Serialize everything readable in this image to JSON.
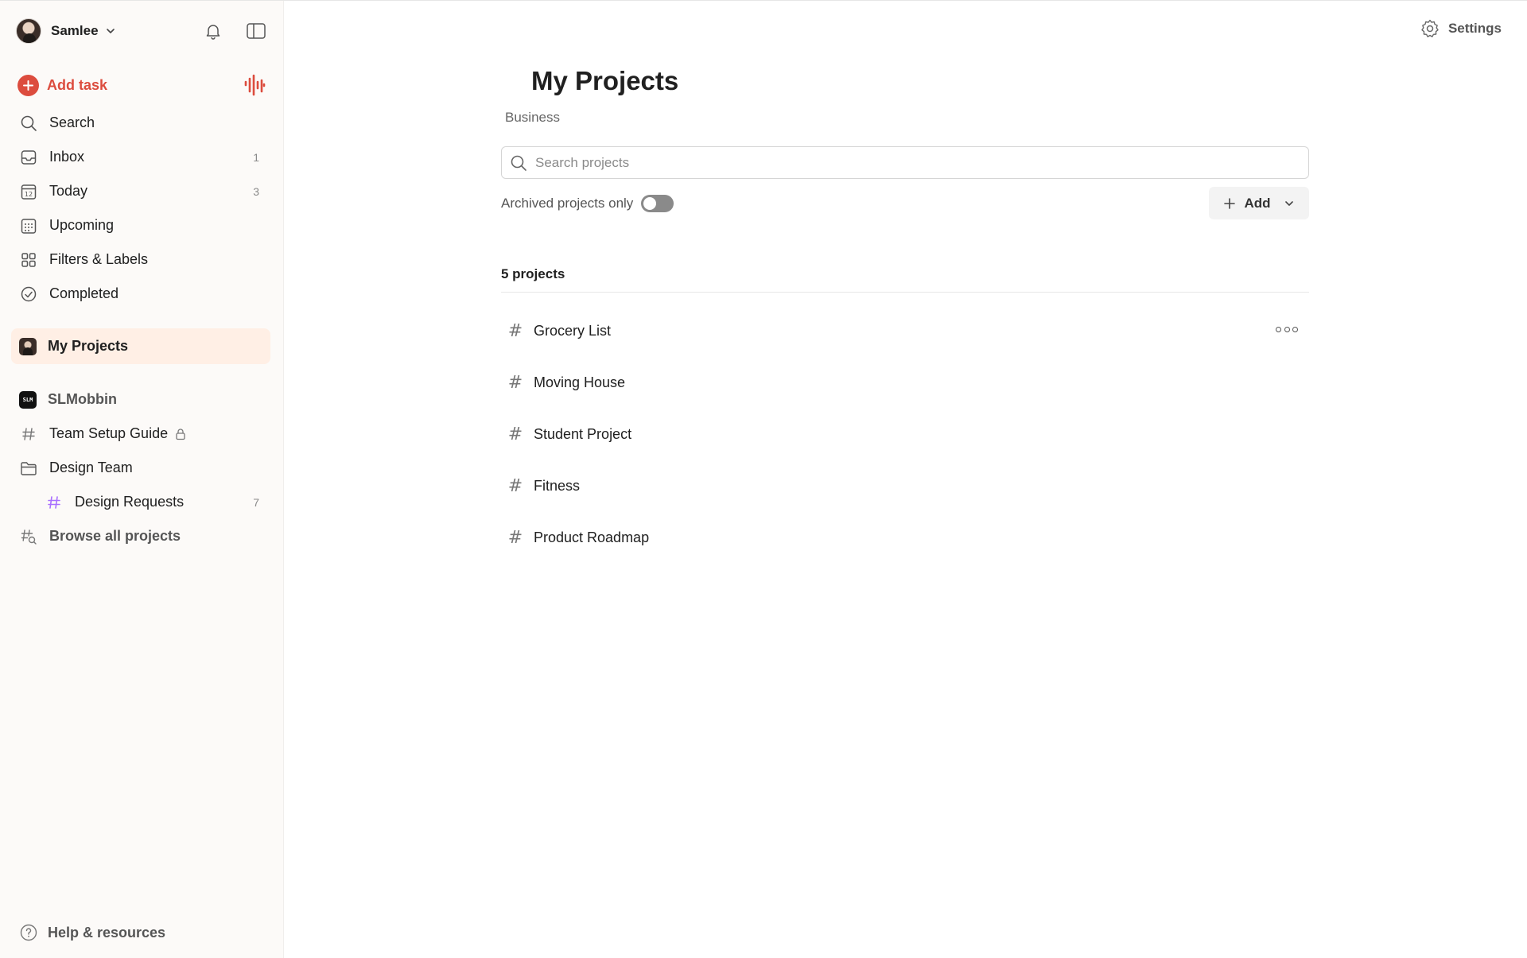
{
  "user": {
    "name": "Samlee"
  },
  "sidebar": {
    "add_task": "Add task",
    "nav": [
      {
        "label": "Search",
        "count": "",
        "icon": "search-icon"
      },
      {
        "label": "Inbox",
        "count": "1",
        "icon": "inbox-icon"
      },
      {
        "label": "Today",
        "count": "3",
        "icon": "calendar-today-icon"
      },
      {
        "label": "Upcoming",
        "count": "",
        "icon": "calendar-grid-icon"
      },
      {
        "label": "Filters & Labels",
        "count": "",
        "icon": "filters-icon"
      },
      {
        "label": "Completed",
        "count": "",
        "icon": "check-circle-icon"
      }
    ],
    "my_projects": "My Projects",
    "team": {
      "name": "SLMobbin",
      "logo_text": "SLM",
      "items": [
        {
          "label": "Team Setup Guide",
          "count": ""
        },
        {
          "label": "Design Team",
          "count": ""
        },
        {
          "label": "Design Requests",
          "count": "7"
        }
      ],
      "browse": "Browse all projects"
    },
    "help": "Help & resources"
  },
  "header": {
    "settings": "Settings"
  },
  "main": {
    "title": "My Projects",
    "subtitle": "Business",
    "search_placeholder": "Search projects",
    "archived_label": "Archived projects only",
    "archived_on": false,
    "add_label": "Add",
    "count_label": "5 projects",
    "projects": [
      {
        "name": "Grocery List"
      },
      {
        "name": "Moving House"
      },
      {
        "name": "Student Project"
      },
      {
        "name": "Fitness"
      },
      {
        "name": "Product Roadmap"
      }
    ]
  },
  "colors": {
    "accent": "#dc4c3e",
    "selected_bg": "#ffefe5",
    "sidebar_bg": "#fcfaf8",
    "hash_purple": "#a970ff"
  }
}
